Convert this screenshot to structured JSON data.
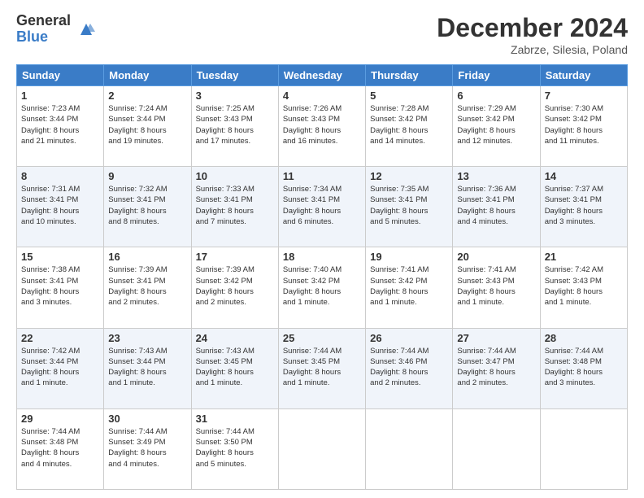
{
  "logo": {
    "general": "General",
    "blue": "Blue"
  },
  "header": {
    "month": "December 2024",
    "location": "Zabrze, Silesia, Poland"
  },
  "weekdays": [
    "Sunday",
    "Monday",
    "Tuesday",
    "Wednesday",
    "Thursday",
    "Friday",
    "Saturday"
  ],
  "rows": [
    [
      {
        "day": "1",
        "lines": [
          "Sunrise: 7:23 AM",
          "Sunset: 3:44 PM",
          "Daylight: 8 hours",
          "and 21 minutes."
        ]
      },
      {
        "day": "2",
        "lines": [
          "Sunrise: 7:24 AM",
          "Sunset: 3:44 PM",
          "Daylight: 8 hours",
          "and 19 minutes."
        ]
      },
      {
        "day": "3",
        "lines": [
          "Sunrise: 7:25 AM",
          "Sunset: 3:43 PM",
          "Daylight: 8 hours",
          "and 17 minutes."
        ]
      },
      {
        "day": "4",
        "lines": [
          "Sunrise: 7:26 AM",
          "Sunset: 3:43 PM",
          "Daylight: 8 hours",
          "and 16 minutes."
        ]
      },
      {
        "day": "5",
        "lines": [
          "Sunrise: 7:28 AM",
          "Sunset: 3:42 PM",
          "Daylight: 8 hours",
          "and 14 minutes."
        ]
      },
      {
        "day": "6",
        "lines": [
          "Sunrise: 7:29 AM",
          "Sunset: 3:42 PM",
          "Daylight: 8 hours",
          "and 12 minutes."
        ]
      },
      {
        "day": "7",
        "lines": [
          "Sunrise: 7:30 AM",
          "Sunset: 3:42 PM",
          "Daylight: 8 hours",
          "and 11 minutes."
        ]
      }
    ],
    [
      {
        "day": "8",
        "lines": [
          "Sunrise: 7:31 AM",
          "Sunset: 3:41 PM",
          "Daylight: 8 hours",
          "and 10 minutes."
        ]
      },
      {
        "day": "9",
        "lines": [
          "Sunrise: 7:32 AM",
          "Sunset: 3:41 PM",
          "Daylight: 8 hours",
          "and 8 minutes."
        ]
      },
      {
        "day": "10",
        "lines": [
          "Sunrise: 7:33 AM",
          "Sunset: 3:41 PM",
          "Daylight: 8 hours",
          "and 7 minutes."
        ]
      },
      {
        "day": "11",
        "lines": [
          "Sunrise: 7:34 AM",
          "Sunset: 3:41 PM",
          "Daylight: 8 hours",
          "and 6 minutes."
        ]
      },
      {
        "day": "12",
        "lines": [
          "Sunrise: 7:35 AM",
          "Sunset: 3:41 PM",
          "Daylight: 8 hours",
          "and 5 minutes."
        ]
      },
      {
        "day": "13",
        "lines": [
          "Sunrise: 7:36 AM",
          "Sunset: 3:41 PM",
          "Daylight: 8 hours",
          "and 4 minutes."
        ]
      },
      {
        "day": "14",
        "lines": [
          "Sunrise: 7:37 AM",
          "Sunset: 3:41 PM",
          "Daylight: 8 hours",
          "and 3 minutes."
        ]
      }
    ],
    [
      {
        "day": "15",
        "lines": [
          "Sunrise: 7:38 AM",
          "Sunset: 3:41 PM",
          "Daylight: 8 hours",
          "and 3 minutes."
        ]
      },
      {
        "day": "16",
        "lines": [
          "Sunrise: 7:39 AM",
          "Sunset: 3:41 PM",
          "Daylight: 8 hours",
          "and 2 minutes."
        ]
      },
      {
        "day": "17",
        "lines": [
          "Sunrise: 7:39 AM",
          "Sunset: 3:42 PM",
          "Daylight: 8 hours",
          "and 2 minutes."
        ]
      },
      {
        "day": "18",
        "lines": [
          "Sunrise: 7:40 AM",
          "Sunset: 3:42 PM",
          "Daylight: 8 hours",
          "and 1 minute."
        ]
      },
      {
        "day": "19",
        "lines": [
          "Sunrise: 7:41 AM",
          "Sunset: 3:42 PM",
          "Daylight: 8 hours",
          "and 1 minute."
        ]
      },
      {
        "day": "20",
        "lines": [
          "Sunrise: 7:41 AM",
          "Sunset: 3:43 PM",
          "Daylight: 8 hours",
          "and 1 minute."
        ]
      },
      {
        "day": "21",
        "lines": [
          "Sunrise: 7:42 AM",
          "Sunset: 3:43 PM",
          "Daylight: 8 hours",
          "and 1 minute."
        ]
      }
    ],
    [
      {
        "day": "22",
        "lines": [
          "Sunrise: 7:42 AM",
          "Sunset: 3:44 PM",
          "Daylight: 8 hours",
          "and 1 minute."
        ]
      },
      {
        "day": "23",
        "lines": [
          "Sunrise: 7:43 AM",
          "Sunset: 3:44 PM",
          "Daylight: 8 hours",
          "and 1 minute."
        ]
      },
      {
        "day": "24",
        "lines": [
          "Sunrise: 7:43 AM",
          "Sunset: 3:45 PM",
          "Daylight: 8 hours",
          "and 1 minute."
        ]
      },
      {
        "day": "25",
        "lines": [
          "Sunrise: 7:44 AM",
          "Sunset: 3:45 PM",
          "Daylight: 8 hours",
          "and 1 minute."
        ]
      },
      {
        "day": "26",
        "lines": [
          "Sunrise: 7:44 AM",
          "Sunset: 3:46 PM",
          "Daylight: 8 hours",
          "and 2 minutes."
        ]
      },
      {
        "day": "27",
        "lines": [
          "Sunrise: 7:44 AM",
          "Sunset: 3:47 PM",
          "Daylight: 8 hours",
          "and 2 minutes."
        ]
      },
      {
        "day": "28",
        "lines": [
          "Sunrise: 7:44 AM",
          "Sunset: 3:48 PM",
          "Daylight: 8 hours",
          "and 3 minutes."
        ]
      }
    ],
    [
      {
        "day": "29",
        "lines": [
          "Sunrise: 7:44 AM",
          "Sunset: 3:48 PM",
          "Daylight: 8 hours",
          "and 4 minutes."
        ]
      },
      {
        "day": "30",
        "lines": [
          "Sunrise: 7:44 AM",
          "Sunset: 3:49 PM",
          "Daylight: 8 hours",
          "and 4 minutes."
        ]
      },
      {
        "day": "31",
        "lines": [
          "Sunrise: 7:44 AM",
          "Sunset: 3:50 PM",
          "Daylight: 8 hours",
          "and 5 minutes."
        ]
      },
      null,
      null,
      null,
      null
    ]
  ]
}
